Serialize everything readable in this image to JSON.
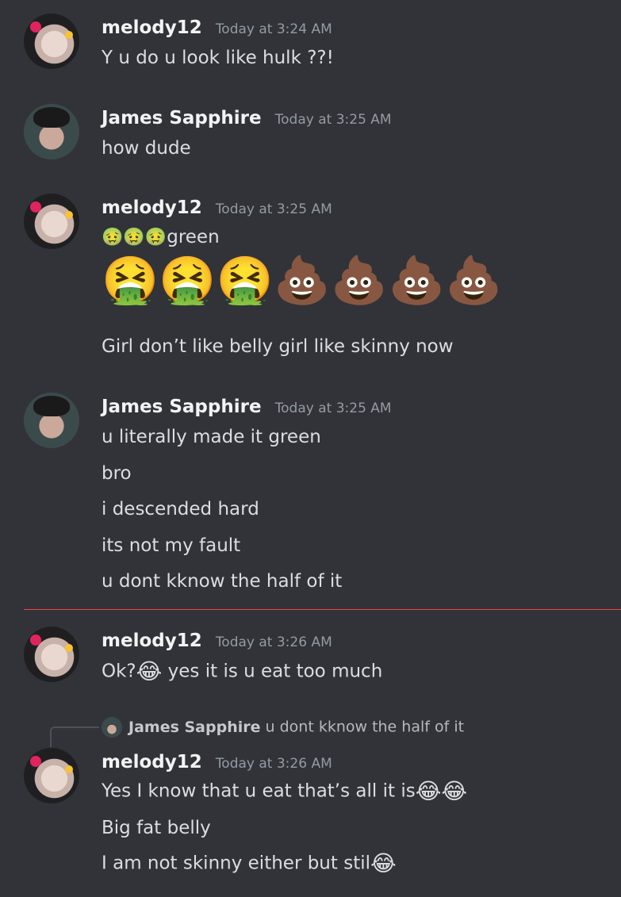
{
  "messages": [
    {
      "author": "melody12",
      "timestamp": "Today at 3:24 AM",
      "lines": [
        "Y u do u look like hulk ??!"
      ]
    },
    {
      "author": "James Sapphire",
      "timestamp": "Today at 3:25 AM",
      "lines": [
        "how dude"
      ]
    },
    {
      "author": "melody12",
      "timestamp": "Today at 3:25 AM",
      "line1_emojis": [
        "🤢",
        "🤢",
        "🤢"
      ],
      "line1_text": "green",
      "big_emojis": [
        "🤮",
        "🤮",
        "🤮",
        "💩",
        "💩",
        "💩",
        "💩"
      ],
      "line3": "Girl don’t like belly girl like skinny now"
    },
    {
      "author": "James Sapphire",
      "timestamp": "Today at 3:25 AM",
      "lines": [
        "u literally made it green",
        "bro",
        "i descended hard",
        "its not my fault",
        "u dont kknow the half of it"
      ]
    },
    {
      "author": "melody12",
      "timestamp": "Today at 3:26 AM",
      "text_before": "Ok?",
      "emoji": "😂",
      "text_after": " yes it is u eat too much"
    },
    {
      "reply": {
        "author": "James Sapphire",
        "text": "u dont kknow the half of it"
      },
      "author": "melody12",
      "timestamp": "Today at 3:26 AM",
      "line1_text": "Yes I know that u eat that’s all it is",
      "line1_emojis": [
        "😂",
        "😂"
      ],
      "line2": "Big fat belly",
      "line3_text": "I am not skinny either but stil",
      "line3_emoji": "😂"
    }
  ]
}
